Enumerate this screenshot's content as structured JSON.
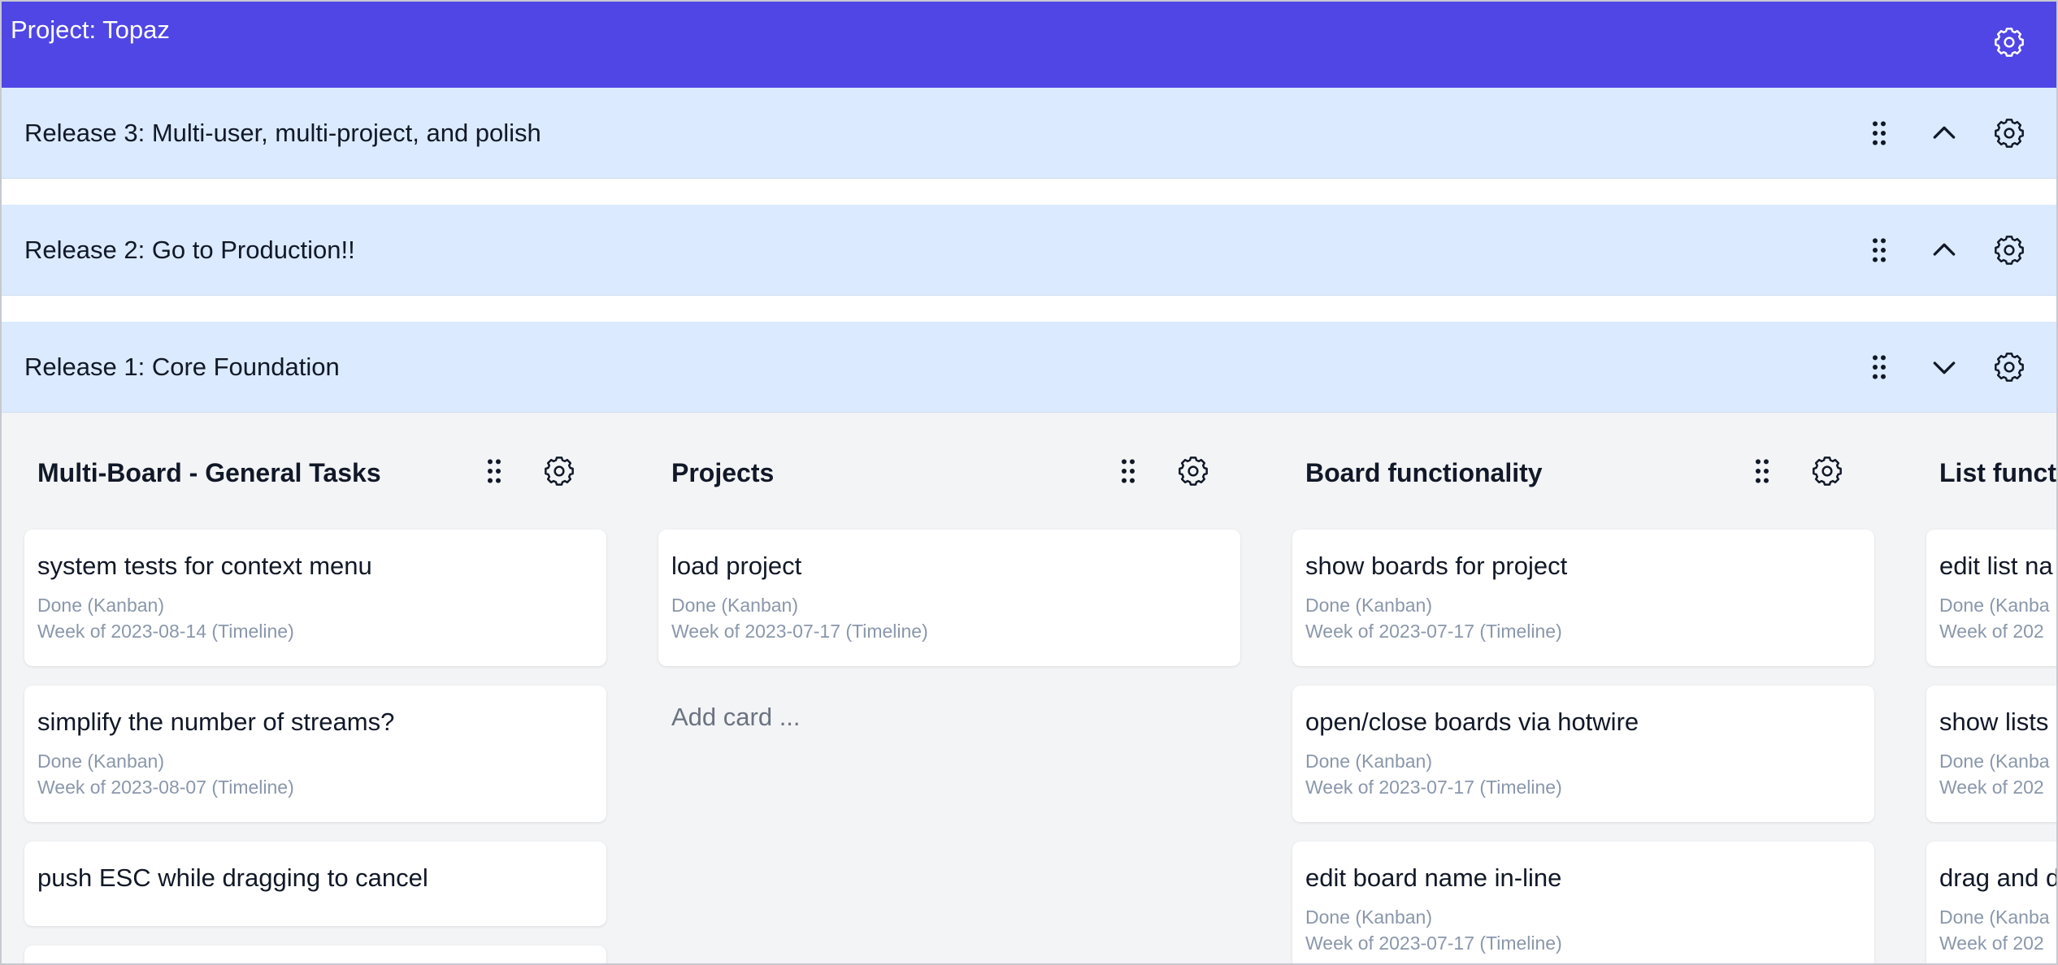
{
  "header": {
    "title": "Project: Topaz"
  },
  "releases": [
    {
      "title": "Release 3: Multi-user, multi-project, and polish",
      "toggle_icon": "chevron-up-icon"
    },
    {
      "title": "Release 2: Go to Production!!",
      "toggle_icon": "chevron-up-icon"
    },
    {
      "title": "Release 1: Core Foundation",
      "toggle_icon": "chevron-down-icon"
    }
  ],
  "lists": [
    {
      "title": "Multi-Board - General Tasks",
      "cards": [
        {
          "title": "system tests for context menu",
          "status": "Done (Kanban)",
          "timeline": "Week of 2023-08-14 (Timeline)"
        },
        {
          "title": "simplify the number of streams?",
          "status": "Done (Kanban)",
          "timeline": "Week of 2023-08-07 (Timeline)"
        },
        {
          "title": "push ESC while dragging to cancel",
          "status": "",
          "timeline": ""
        }
      ]
    },
    {
      "title": "Projects",
      "cards": [
        {
          "title": "load project",
          "status": "Done (Kanban)",
          "timeline": "Week of 2023-07-17 (Timeline)"
        }
      ],
      "add_card_label": "Add card ..."
    },
    {
      "title": "Board functionality",
      "cards": [
        {
          "title": "show boards for project",
          "status": "Done (Kanban)",
          "timeline": "Week of 2023-07-17 (Timeline)"
        },
        {
          "title": "open/close boards via hotwire",
          "status": "Done (Kanban)",
          "timeline": "Week of 2023-07-17 (Timeline)"
        },
        {
          "title": "edit board name in-line",
          "status": "Done (Kanban)",
          "timeline": "Week of 2023-07-17 (Timeline)"
        }
      ]
    },
    {
      "title": "List funct",
      "cards": [
        {
          "title": "edit list na",
          "status": "Done (Kanba",
          "timeline": "Week of 202"
        },
        {
          "title": "show lists",
          "status": "Done (Kanba",
          "timeline": "Week of 202"
        },
        {
          "title": "drag and d",
          "status": "Done (Kanba",
          "timeline": "Week of 202"
        }
      ]
    }
  ],
  "colors": {
    "header_bg": "#4f46e5",
    "release_bg": "#dbeafe",
    "board_bg": "#f3f4f6",
    "meta_text": "#8a97ab"
  }
}
